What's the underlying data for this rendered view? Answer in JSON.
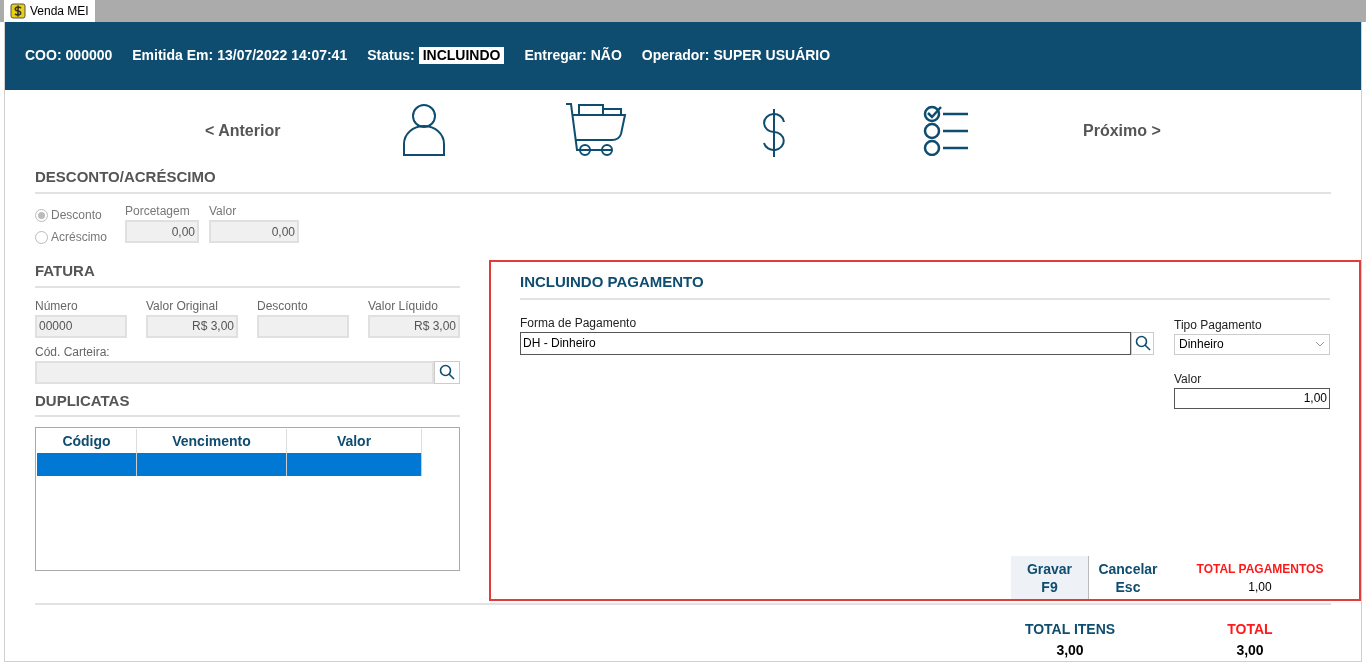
{
  "tab": {
    "title": "Venda MEI"
  },
  "header": {
    "fields": [
      {
        "label": "COO:",
        "value": "000000",
        "kind": "plain"
      },
      {
        "label": "Emitida Em:",
        "value": "13/07/2022 14:07:41",
        "kind": "plain"
      },
      {
        "label": "Status:",
        "value": "INCLUINDO",
        "kind": "badge"
      },
      {
        "label": "Entregar:",
        "value": "NÃO",
        "kind": "plain"
      },
      {
        "label": "Operador:",
        "value": "SUPER USUÁRIO",
        "kind": "plain"
      }
    ]
  },
  "nav": {
    "previous": "< Anterior",
    "next": "Próximo >"
  },
  "discount": {
    "title": "DESCONTO/ACRÉSCIMO",
    "options": [
      {
        "label": "Desconto",
        "selected": true
      },
      {
        "label": "Acréscimo",
        "selected": false
      }
    ],
    "fields": [
      {
        "label": "Porcetagem",
        "value": "0,00"
      },
      {
        "label": "Valor",
        "value": "0,00"
      }
    ]
  },
  "invoice": {
    "title": "FATURA",
    "fields": [
      {
        "label": "Número",
        "value": "00000",
        "kind": "text"
      },
      {
        "label": "Valor Original",
        "value": "R$ 3,00",
        "kind": "amount"
      },
      {
        "label": "Desconto",
        "kind": "amount"
      },
      {
        "label": "Valor Líquido",
        "value": "R$ 3,00",
        "kind": "amount"
      }
    ],
    "wallet": {
      "label": "Cód. Carteira:"
    }
  },
  "duplicates": {
    "title": "DUPLICATAS",
    "columns": [
      "Código",
      "Vencimento",
      "Valor"
    ],
    "rows": [
      {
        "selected": true
      }
    ]
  },
  "payment": {
    "title": "INCLUINDO PAGAMENTO",
    "method": {
      "label": "Forma de Pagamento",
      "value": "DH - Dinheiro"
    },
    "type": {
      "label": "Tipo Pagamento",
      "value": "Dinheiro"
    },
    "amount": {
      "label": "Valor",
      "value": "1,00"
    },
    "buttons": [
      {
        "label": "Gravar",
        "shortcut": "F9",
        "focused": true
      },
      {
        "label": "Cancelar",
        "shortcut": "Esc",
        "focused": false
      }
    ],
    "total": {
      "label": "TOTAL PAGAMENTOS",
      "value": "1,00"
    }
  },
  "totals": [
    {
      "label": "TOTAL ITENS",
      "value": "3,00",
      "kind": "items"
    },
    {
      "label": "TOTAL",
      "value": "3,00",
      "kind": "grand"
    }
  ]
}
